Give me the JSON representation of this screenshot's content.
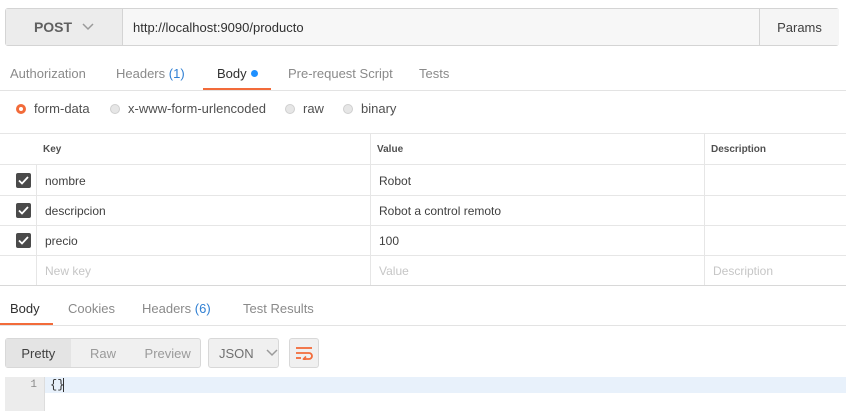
{
  "request": {
    "method": "POST",
    "url": "http://localhost:9090/producto",
    "params_label": "Params"
  },
  "request_tabs": [
    {
      "label": "Authorization"
    },
    {
      "label": "Headers",
      "count": "(1)"
    },
    {
      "label": "Body",
      "active": true
    },
    {
      "label": "Pre-request Script"
    },
    {
      "label": "Tests"
    }
  ],
  "body_types": [
    {
      "label": "form-data",
      "selected": true
    },
    {
      "label": "x-www-form-urlencoded"
    },
    {
      "label": "raw"
    },
    {
      "label": "binary"
    }
  ],
  "table": {
    "headers": [
      "Key",
      "Value",
      "Description"
    ],
    "rows": [
      {
        "checked": true,
        "key": "nombre",
        "value": "Robot",
        "description": ""
      },
      {
        "checked": true,
        "key": "descripcion",
        "value": "Robot a control remoto",
        "description": ""
      },
      {
        "checked": true,
        "key": "precio",
        "value": "100",
        "description": ""
      }
    ],
    "placeholders": {
      "key": "New key",
      "value": "Value",
      "description": "Description"
    }
  },
  "response_tabs": [
    {
      "label": "Body",
      "active": true
    },
    {
      "label": "Cookies"
    },
    {
      "label": "Headers",
      "count": "(6)"
    },
    {
      "label": "Test Results"
    }
  ],
  "view_modes": [
    "Pretty",
    "Raw",
    "Preview"
  ],
  "format": "JSON",
  "editor": {
    "line_number": "1",
    "content": "{}"
  },
  "colors": {
    "accent": "#f26b3a",
    "link": "#2f7fd3",
    "indicator": "#1e90ff"
  }
}
